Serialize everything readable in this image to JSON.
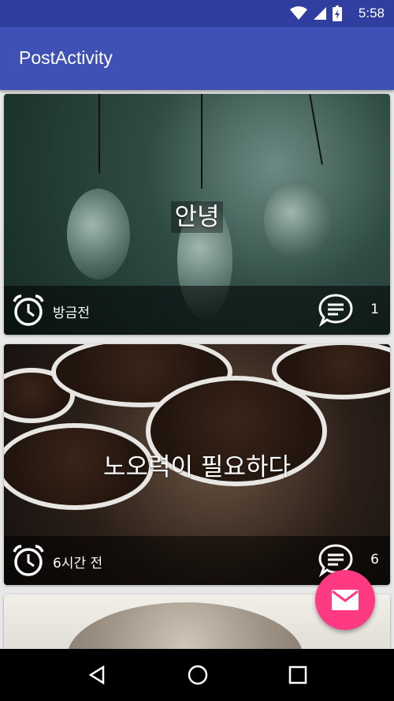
{
  "status_bar": {
    "time": "5:58",
    "icons": [
      "wifi-icon",
      "signal-icon",
      "battery-icon"
    ]
  },
  "app_bar": {
    "title": "PostActivity"
  },
  "posts": [
    {
      "title": "안녕",
      "time": "방금전",
      "comments": "1",
      "image": "hanging-light-bulbs-photo"
    },
    {
      "title": "노오력이 필요하다",
      "time": "6시간 전",
      "comments": "6",
      "image": "coffee-bean-cups-photo"
    },
    {
      "image": "kitten-photo"
    }
  ],
  "fab": {
    "icon": "mail-icon",
    "color": "#ff3a82"
  },
  "nav_bar": {
    "icons": [
      "back-icon",
      "home-icon",
      "recents-icon"
    ]
  },
  "colors": {
    "primary": "#3f51b5",
    "primary_dark": "#303f9f",
    "accent": "#ff3a82"
  }
}
